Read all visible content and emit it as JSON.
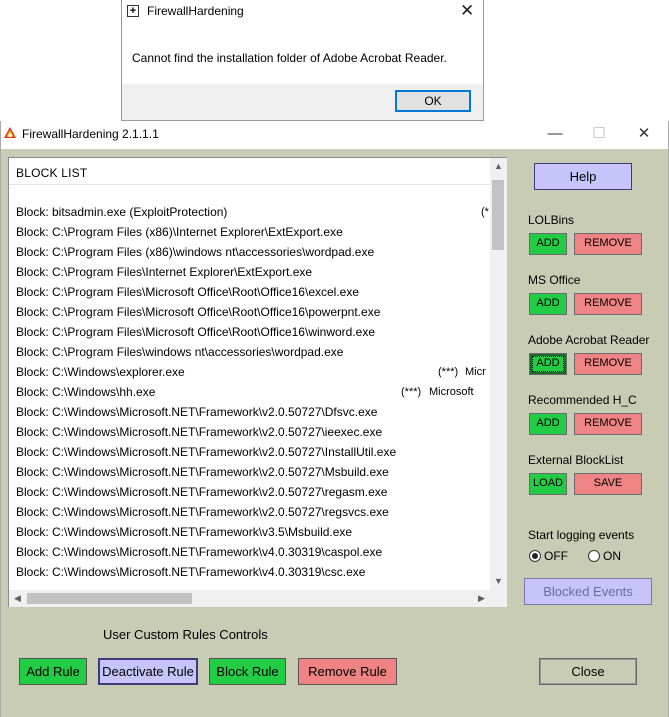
{
  "dialog": {
    "title": "FirewallHardening",
    "message": "Cannot find the installation folder of Adobe Acrobat Reader.",
    "ok_label": "OK",
    "close_glyph": "✕",
    "icon": "app-window-icon"
  },
  "window": {
    "title": "FirewallHardening 2.1.1.1",
    "minimize_glyph": "—",
    "maximize_glyph": "☐",
    "close_glyph": "✕"
  },
  "list": {
    "header": "BLOCK  LIST",
    "rows": [
      "Block: bitsadmin.exe (ExploitProtection)",
      "Block: C:\\Program Files (x86)\\Internet Explorer\\ExtExport.exe",
      "Block: C:\\Program Files (x86)\\windows nt\\accessories\\wordpad.exe",
      "Block: C:\\Program Files\\Internet Explorer\\ExtExport.exe",
      "Block: C:\\Program Files\\Microsoft Office\\Root\\Office16\\excel.exe",
      "Block: C:\\Program Files\\Microsoft Office\\Root\\Office16\\powerpnt.exe",
      "Block: C:\\Program Files\\Microsoft Office\\Root\\Office16\\winword.exe",
      "Block: C:\\Program Files\\windows nt\\accessories\\wordpad.exe",
      "Block: C:\\Windows\\explorer.exe",
      "Block: C:\\Windows\\hh.exe",
      "Block: C:\\Windows\\Microsoft.NET\\Framework\\v2.0.50727\\Dfsvc.exe",
      "Block: C:\\Windows\\Microsoft.NET\\Framework\\v2.0.50727\\ieexec.exe",
      "Block: C:\\Windows\\Microsoft.NET\\Framework\\v2.0.50727\\InstallUtil.exe",
      "Block: C:\\Windows\\Microsoft.NET\\Framework\\v2.0.50727\\Msbuild.exe",
      "Block: C:\\Windows\\Microsoft.NET\\Framework\\v2.0.50727\\regasm.exe",
      "Block: C:\\Windows\\Microsoft.NET\\Framework\\v2.0.50727\\regsvcs.exe",
      "Block: C:\\Windows\\Microsoft.NET\\Framework\\v3.5\\Msbuild.exe",
      "Block: C:\\Windows\\Microsoft.NET\\Framework\\v4.0.30319\\caspol.exe",
      "Block: C:\\Windows\\Microsoft.NET\\Framework\\v4.0.30319\\csc.exe"
    ],
    "row0_suffix": "(*",
    "row8_suffix_marker": "(***)",
    "row8_suffix_text": "Micr",
    "row9_suffix_marker": "(***)",
    "row9_suffix_text": "Microsoft"
  },
  "panel": {
    "help_label": "Help",
    "lolbins": {
      "label": "LOLBins",
      "add": "ADD",
      "remove": "REMOVE"
    },
    "msoffice": {
      "label": "MS Office",
      "add": "ADD",
      "remove": "REMOVE"
    },
    "adobe": {
      "label": "Adobe Acrobat Reader",
      "add": "ADD",
      "remove": "REMOVE"
    },
    "recommended": {
      "label": "Recommended H_C",
      "add": "ADD",
      "remove": "REMOVE"
    },
    "external": {
      "label": "External BlockList",
      "load": "LOAD",
      "save": "SAVE"
    },
    "logging": {
      "label": "Start logging events",
      "off": "OFF",
      "on": "ON",
      "selected": "OFF"
    },
    "blocked_events_label": "Blocked Events"
  },
  "custom": {
    "title": "User Custom Rules Controls",
    "add_rule": "Add Rule",
    "deactivate_rule": "Deactivate Rule",
    "block_rule": "Block Rule",
    "remove_rule": "Remove Rule",
    "close": "Close"
  },
  "colors": {
    "window_bg": "#c8ccb4",
    "green_button": "#22cc44",
    "red_button": "#f08484",
    "purple_button": "#c6c4fa"
  }
}
